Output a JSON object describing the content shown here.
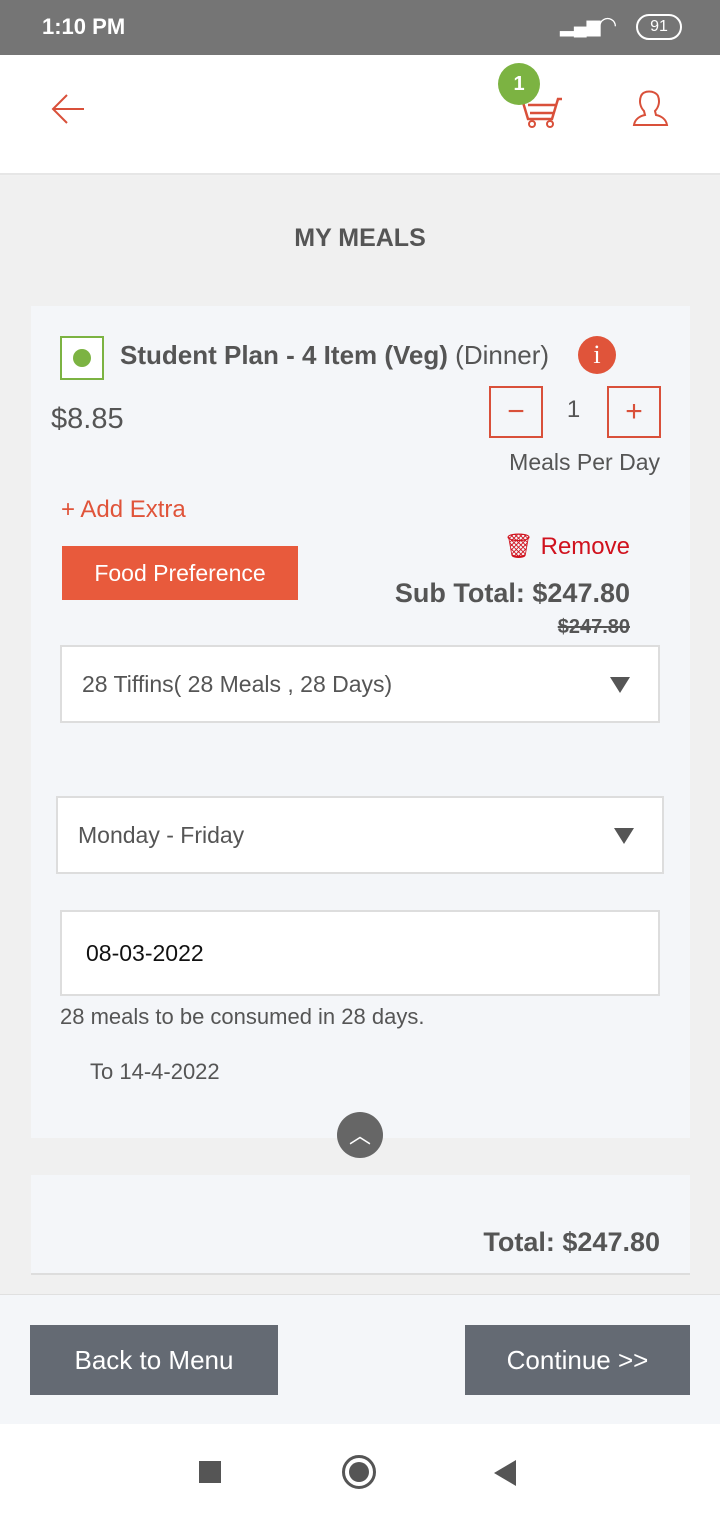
{
  "status_bar": {
    "time": "1:10 PM",
    "battery": "91"
  },
  "header": {
    "cart_count": "1",
    "icons": [
      "back-arrow-icon",
      "cart-icon",
      "user-icon"
    ]
  },
  "page_title": "MY MEALS",
  "meal": {
    "name": "Student Plan - 4 Item (Veg)",
    "meal_type": "(Dinner)",
    "price": "$8.85",
    "quantity": "1",
    "quantity_label": "Meals Per Day",
    "add_extra": "Add Extra",
    "food_preference": "Food Preference",
    "remove": "Remove",
    "sub_total": "Sub Total: $247.80",
    "original_total": "$247.80",
    "plan_select": "28 Tiffins( 28 Meals , 28 Days)",
    "days_select": "Monday - Friday",
    "start_date": "08-03-2022",
    "consume_note": "28 meals to be consumed in 28 days.",
    "end_date": "To 14-4-2022"
  },
  "total": "Total: $247.80",
  "footer": {
    "back": "Back to Menu",
    "continue": "Continue >>"
  },
  "colors": {
    "accent": "#e0543a",
    "badge": "#7cb342",
    "button": "#646a73"
  }
}
